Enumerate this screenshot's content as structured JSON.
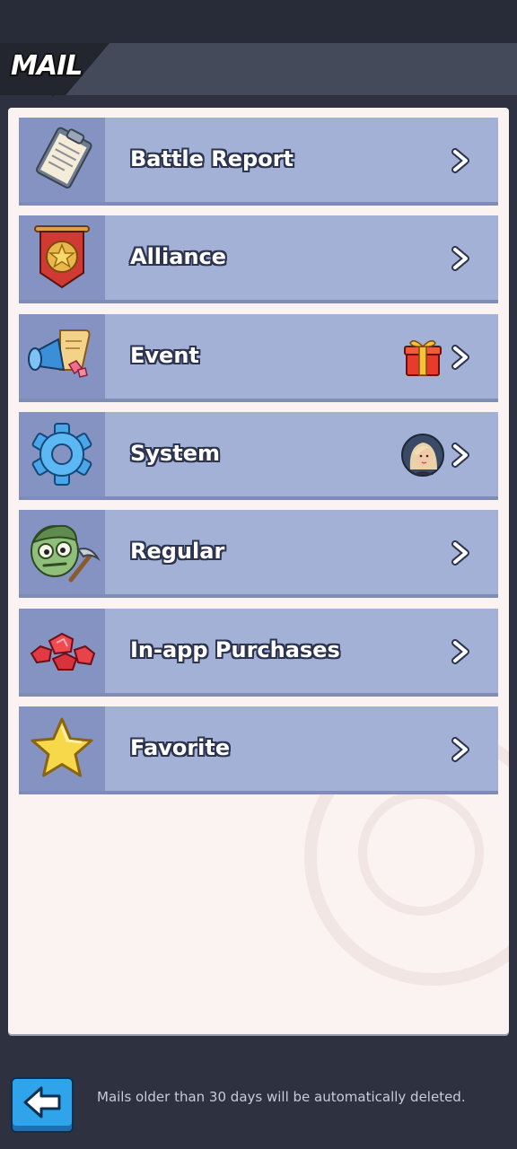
{
  "header": {
    "title": "MAIL"
  },
  "rows": [
    {
      "label": "Battle Report",
      "icon": "clipboard-icon",
      "badge": null
    },
    {
      "label": "Alliance",
      "icon": "alliance-banner-icon",
      "badge": null
    },
    {
      "label": "Event",
      "icon": "megaphone-icon",
      "badge": "gift-box-icon"
    },
    {
      "label": "System",
      "icon": "gear-icon",
      "badge": "avatar-portrait"
    },
    {
      "label": "Regular",
      "icon": "zombie-head-icon",
      "badge": null
    },
    {
      "label": "In-app Purchases",
      "icon": "gems-icon",
      "badge": null
    },
    {
      "label": "Favorite",
      "icon": "star-icon",
      "badge": null
    }
  ],
  "footer": {
    "note": "Mails older than 30 days will be automatically deleted.",
    "back_icon": "back-arrow-icon"
  },
  "colors": {
    "row_bg": "#a3b1d6",
    "icon_bg": "#8493c2",
    "panel_bg": "#fbf3f2",
    "back_button": "#2fa4ea"
  }
}
